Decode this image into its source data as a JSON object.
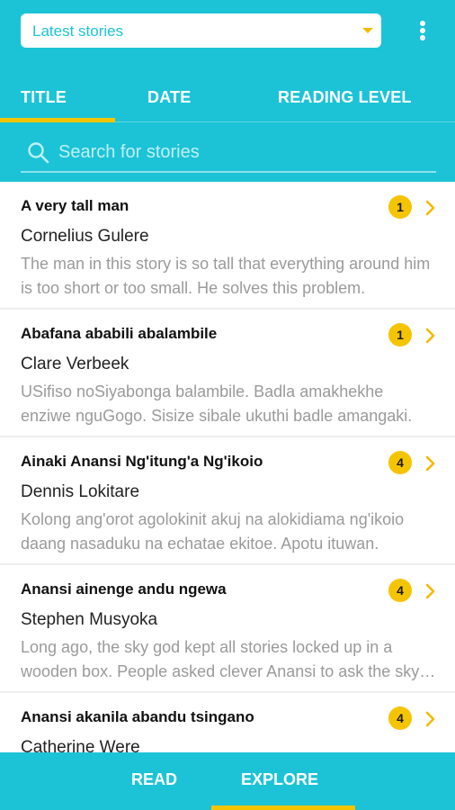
{
  "header": {
    "dropdown_label": "Latest stories",
    "tabs": [
      {
        "label": "TITLE",
        "active": true
      },
      {
        "label": "DATE",
        "active": false
      },
      {
        "label": "READING LEVEL",
        "active": false
      }
    ],
    "search_placeholder": "Search for stories"
  },
  "stories": [
    {
      "title": "A very tall man",
      "author": "Cornelius Gulere",
      "description": "The man in this story is so tall that everything around him is too short or too small. He solves this problem.",
      "level": "1"
    },
    {
      "title": "Abafana ababili abalambile",
      "author": "Clare Verbeek",
      "description": "USifiso noSiyabonga balambile. Badla amakhekhe enziwe nguGogo. Sisize sibale ukuthi badle amangaki.",
      "level": "1"
    },
    {
      "title": "Ainaki Anansi Ng'itung'a Ng'ikoio",
      "author": "Dennis Lokitare",
      "description": "Kolong ang'orot agolokinit akuj na alokidiama ng'ikoio daang nasaduku na echatae ekitoe. Apotu ituwan.",
      "level": "4"
    },
    {
      "title": "Anansi ainenge andu ngewa",
      "author": "Stephen Musyoka",
      "description": "Long ago, the sky god kept all stories locked up in a wooden box. People asked clever Anansi to ask the sky god.",
      "level": "4"
    },
    {
      "title": "Anansi akanila abandu tsingano",
      "author": "Catherine Were",
      "description": "",
      "level": "4"
    }
  ],
  "bottom_nav": {
    "items": [
      {
        "label": "READ",
        "active": false
      },
      {
        "label": "EXPLORE",
        "active": true
      }
    ]
  },
  "colors": {
    "primary": "#1cc3d6",
    "accent": "#f5c400",
    "icons": [
      "caret-down-icon",
      "more-vert-icon",
      "search-icon",
      "chevron-right-icon"
    ]
  }
}
